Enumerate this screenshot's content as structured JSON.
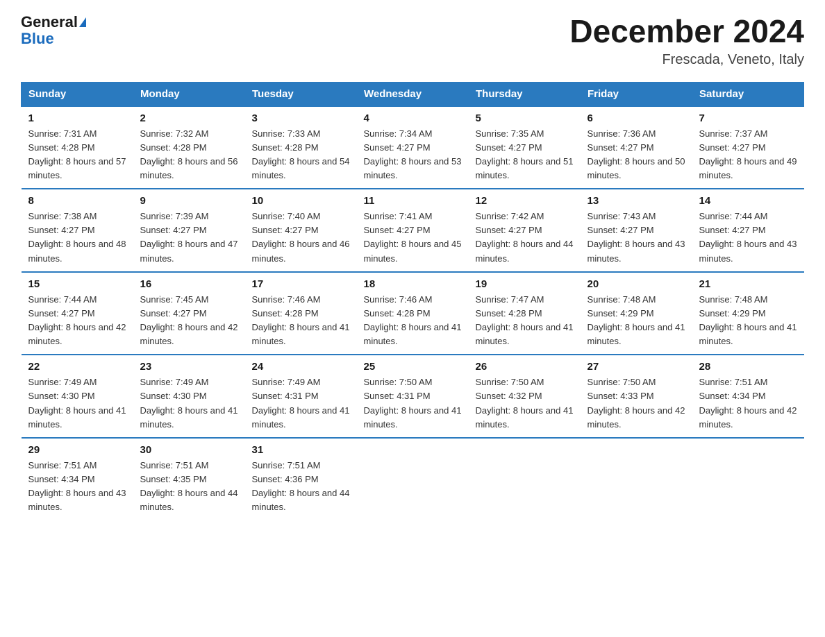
{
  "header": {
    "logo_line1": "General",
    "logo_triangle": "▶",
    "logo_line2": "Blue",
    "month_title": "December 2024",
    "location": "Frescada, Veneto, Italy"
  },
  "days_of_week": [
    "Sunday",
    "Monday",
    "Tuesday",
    "Wednesday",
    "Thursday",
    "Friday",
    "Saturday"
  ],
  "weeks": [
    [
      {
        "day": "1",
        "sunrise": "7:31 AM",
        "sunset": "4:28 PM",
        "daylight": "8 hours and 57 minutes."
      },
      {
        "day": "2",
        "sunrise": "7:32 AM",
        "sunset": "4:28 PM",
        "daylight": "8 hours and 56 minutes."
      },
      {
        "day": "3",
        "sunrise": "7:33 AM",
        "sunset": "4:28 PM",
        "daylight": "8 hours and 54 minutes."
      },
      {
        "day": "4",
        "sunrise": "7:34 AM",
        "sunset": "4:27 PM",
        "daylight": "8 hours and 53 minutes."
      },
      {
        "day": "5",
        "sunrise": "7:35 AM",
        "sunset": "4:27 PM",
        "daylight": "8 hours and 51 minutes."
      },
      {
        "day": "6",
        "sunrise": "7:36 AM",
        "sunset": "4:27 PM",
        "daylight": "8 hours and 50 minutes."
      },
      {
        "day": "7",
        "sunrise": "7:37 AM",
        "sunset": "4:27 PM",
        "daylight": "8 hours and 49 minutes."
      }
    ],
    [
      {
        "day": "8",
        "sunrise": "7:38 AM",
        "sunset": "4:27 PM",
        "daylight": "8 hours and 48 minutes."
      },
      {
        "day": "9",
        "sunrise": "7:39 AM",
        "sunset": "4:27 PM",
        "daylight": "8 hours and 47 minutes."
      },
      {
        "day": "10",
        "sunrise": "7:40 AM",
        "sunset": "4:27 PM",
        "daylight": "8 hours and 46 minutes."
      },
      {
        "day": "11",
        "sunrise": "7:41 AM",
        "sunset": "4:27 PM",
        "daylight": "8 hours and 45 minutes."
      },
      {
        "day": "12",
        "sunrise": "7:42 AM",
        "sunset": "4:27 PM",
        "daylight": "8 hours and 44 minutes."
      },
      {
        "day": "13",
        "sunrise": "7:43 AM",
        "sunset": "4:27 PM",
        "daylight": "8 hours and 43 minutes."
      },
      {
        "day": "14",
        "sunrise": "7:44 AM",
        "sunset": "4:27 PM",
        "daylight": "8 hours and 43 minutes."
      }
    ],
    [
      {
        "day": "15",
        "sunrise": "7:44 AM",
        "sunset": "4:27 PM",
        "daylight": "8 hours and 42 minutes."
      },
      {
        "day": "16",
        "sunrise": "7:45 AM",
        "sunset": "4:27 PM",
        "daylight": "8 hours and 42 minutes."
      },
      {
        "day": "17",
        "sunrise": "7:46 AM",
        "sunset": "4:28 PM",
        "daylight": "8 hours and 41 minutes."
      },
      {
        "day": "18",
        "sunrise": "7:46 AM",
        "sunset": "4:28 PM",
        "daylight": "8 hours and 41 minutes."
      },
      {
        "day": "19",
        "sunrise": "7:47 AM",
        "sunset": "4:28 PM",
        "daylight": "8 hours and 41 minutes."
      },
      {
        "day": "20",
        "sunrise": "7:48 AM",
        "sunset": "4:29 PM",
        "daylight": "8 hours and 41 minutes."
      },
      {
        "day": "21",
        "sunrise": "7:48 AM",
        "sunset": "4:29 PM",
        "daylight": "8 hours and 41 minutes."
      }
    ],
    [
      {
        "day": "22",
        "sunrise": "7:49 AM",
        "sunset": "4:30 PM",
        "daylight": "8 hours and 41 minutes."
      },
      {
        "day": "23",
        "sunrise": "7:49 AM",
        "sunset": "4:30 PM",
        "daylight": "8 hours and 41 minutes."
      },
      {
        "day": "24",
        "sunrise": "7:49 AM",
        "sunset": "4:31 PM",
        "daylight": "8 hours and 41 minutes."
      },
      {
        "day": "25",
        "sunrise": "7:50 AM",
        "sunset": "4:31 PM",
        "daylight": "8 hours and 41 minutes."
      },
      {
        "day": "26",
        "sunrise": "7:50 AM",
        "sunset": "4:32 PM",
        "daylight": "8 hours and 41 minutes."
      },
      {
        "day": "27",
        "sunrise": "7:50 AM",
        "sunset": "4:33 PM",
        "daylight": "8 hours and 42 minutes."
      },
      {
        "day": "28",
        "sunrise": "7:51 AM",
        "sunset": "4:34 PM",
        "daylight": "8 hours and 42 minutes."
      }
    ],
    [
      {
        "day": "29",
        "sunrise": "7:51 AM",
        "sunset": "4:34 PM",
        "daylight": "8 hours and 43 minutes."
      },
      {
        "day": "30",
        "sunrise": "7:51 AM",
        "sunset": "4:35 PM",
        "daylight": "8 hours and 44 minutes."
      },
      {
        "day": "31",
        "sunrise": "7:51 AM",
        "sunset": "4:36 PM",
        "daylight": "8 hours and 44 minutes."
      },
      {
        "day": "",
        "sunrise": "",
        "sunset": "",
        "daylight": ""
      },
      {
        "day": "",
        "sunrise": "",
        "sunset": "",
        "daylight": ""
      },
      {
        "day": "",
        "sunrise": "",
        "sunset": "",
        "daylight": ""
      },
      {
        "day": "",
        "sunrise": "",
        "sunset": "",
        "daylight": ""
      }
    ]
  ]
}
